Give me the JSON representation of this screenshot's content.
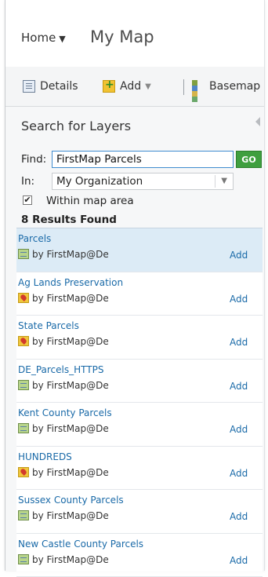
{
  "header": {
    "home_label": "Home",
    "map_title": "My Map"
  },
  "toolbar": {
    "details_label": "Details",
    "add_label": "Add",
    "basemap_label": "Basemap"
  },
  "search": {
    "title": "Search for Layers",
    "find_label": "Find:",
    "find_value": "FirstMap Parcels",
    "go_label": "GO",
    "in_label": "In:",
    "in_value": "My Organization",
    "within_label": "Within map area",
    "within_checked": true,
    "results_count": "8 Results Found"
  },
  "results": [
    {
      "title": "Parcels",
      "owner": "by FirstMap@De",
      "add": "Add",
      "icon": "map-layer-icon",
      "selected": true
    },
    {
      "title": "Ag Lands Preservation",
      "owner": "by FirstMap@De",
      "add": "Add",
      "icon": "feature-layer-icon"
    },
    {
      "title": "State Parcels",
      "owner": "by FirstMap@De",
      "add": "Add",
      "icon": "feature-layer-icon"
    },
    {
      "title": "DE_Parcels_HTTPS",
      "owner": "by FirstMap@De",
      "add": "Add",
      "icon": "map-layer-icon"
    },
    {
      "title": "Kent County Parcels",
      "owner": "by FirstMap@De",
      "add": "Add",
      "icon": "map-layer-icon"
    },
    {
      "title": "HUNDREDS",
      "owner": "by FirstMap@De",
      "add": "Add",
      "icon": "feature-layer-icon"
    },
    {
      "title": "Sussex County Parcels",
      "owner": "by FirstMap@De",
      "add": "Add",
      "icon": "map-layer-icon"
    },
    {
      "title": "New Castle County Parcels",
      "owner": "by FirstMap@De",
      "add": "Add",
      "icon": "map-layer-icon"
    }
  ],
  "colors": {
    "link": "#1a6aa8",
    "go_button": "#3f9f3f",
    "selected_row": "#dcebf6",
    "input_border": "#3f8ccf"
  }
}
